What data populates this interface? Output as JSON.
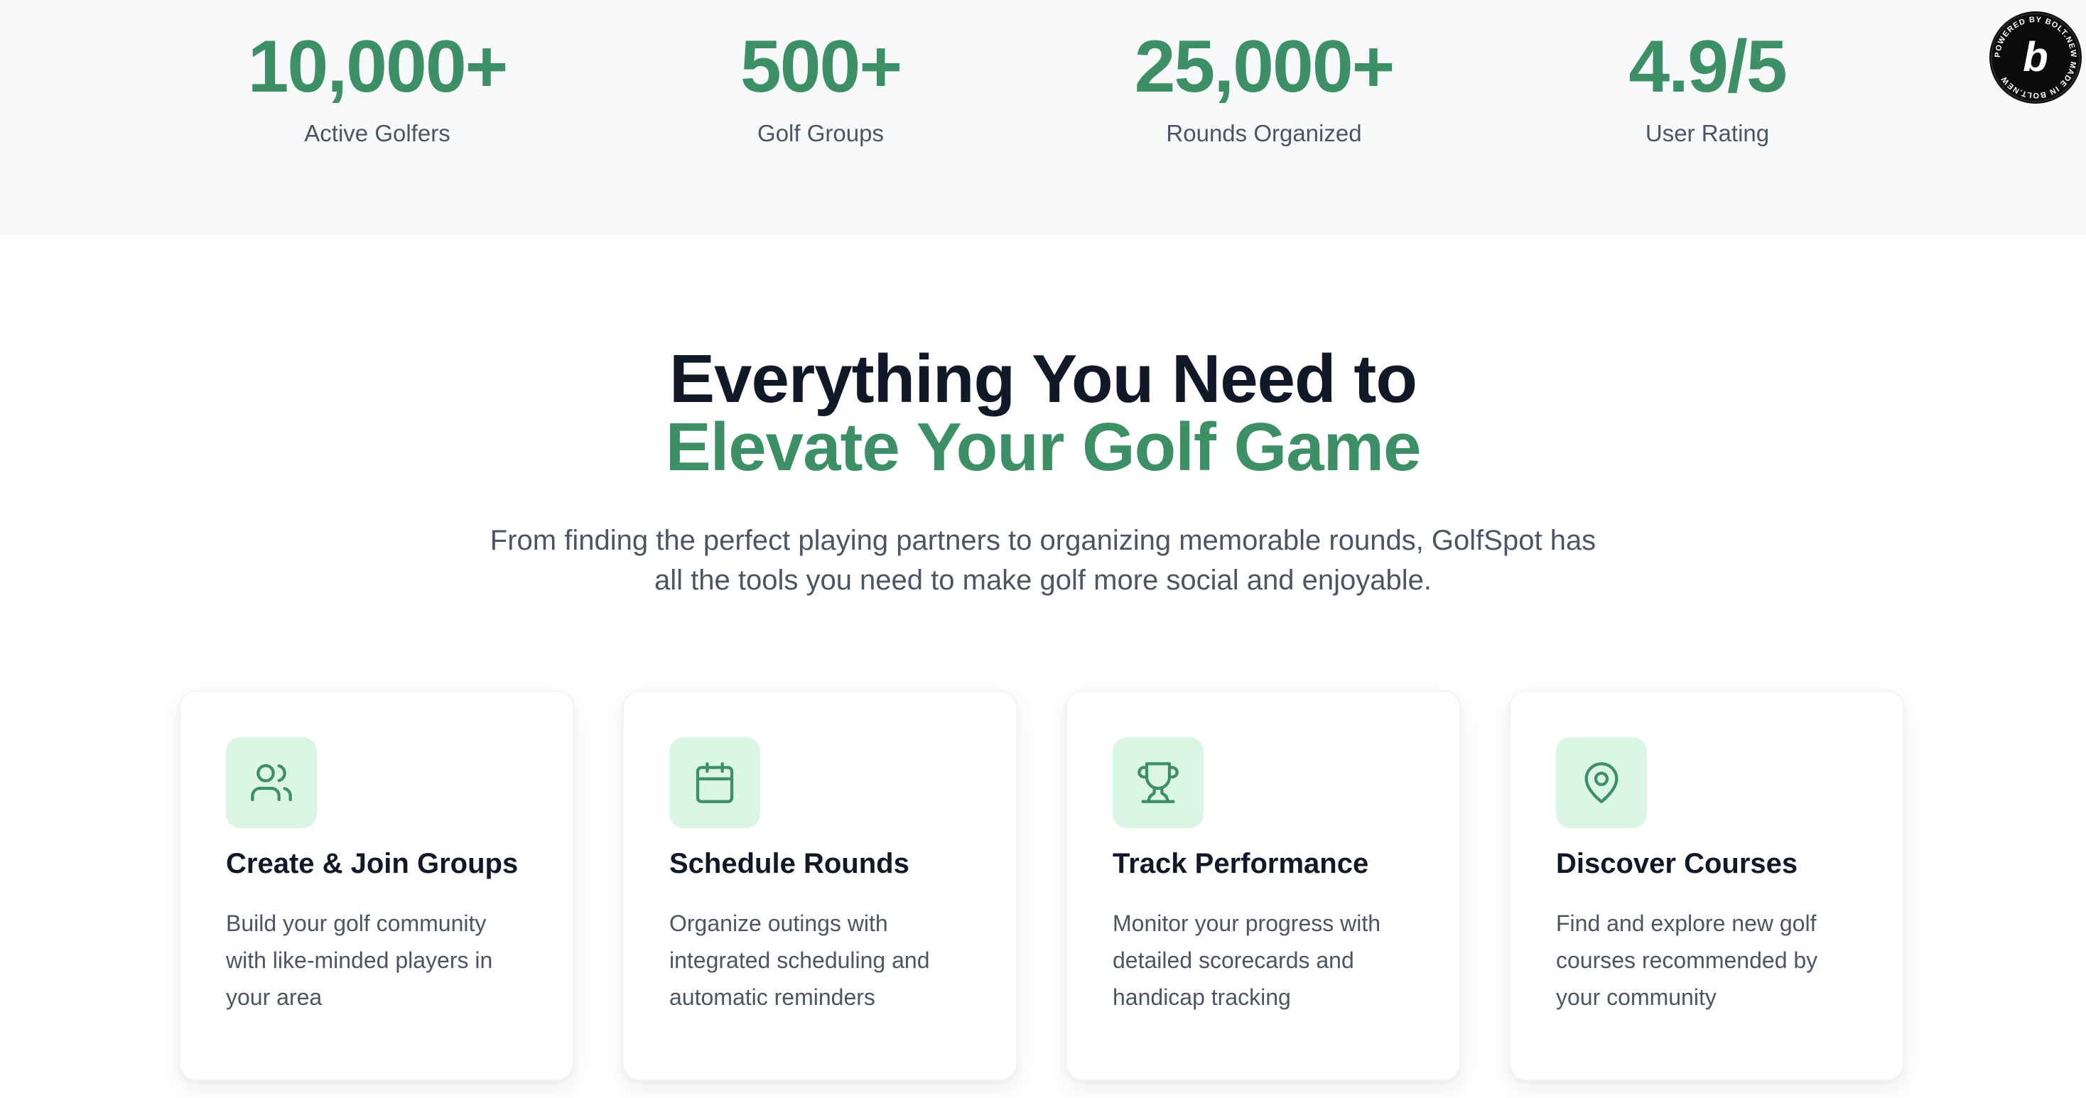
{
  "stats": [
    {
      "value": "10,000+",
      "label": "Active Golfers"
    },
    {
      "value": "500+",
      "label": "Golf Groups"
    },
    {
      "value": "25,000+",
      "label": "Rounds Organized"
    },
    {
      "value": "4.9/5",
      "label": "User Rating"
    }
  ],
  "badge": {
    "icon": "bolt-logo-icon",
    "letter": "b",
    "ring_text": "POWERED BY BOLT.NEW MADE IN BOLT.NEW"
  },
  "features": {
    "heading_line1": "Everything You Need to",
    "heading_line2": "Elevate Your Golf Game",
    "subtitle": "From finding the perfect playing partners to organizing memorable rounds, GolfSpot has all the tools you need to make golf more social and enjoyable.",
    "cards": [
      {
        "icon": "users-icon",
        "title": "Create & Join Groups",
        "description": "Build your golf community with like-minded players in your area"
      },
      {
        "icon": "calendar-icon",
        "title": "Schedule Rounds",
        "description": "Organize outings with integrated scheduling and automatic reminders"
      },
      {
        "icon": "trophy-icon",
        "title": "Track Performance",
        "description": "Monitor your progress with detailed scorecards and handicap tracking"
      },
      {
        "icon": "map-pin-icon",
        "title": "Discover Courses",
        "description": "Find and explore new golf courses recommended by your community"
      }
    ]
  },
  "colors": {
    "accent": "#3d8f65",
    "icon_bg": "#dcf6e6",
    "heading": "#111827",
    "body_text": "#4b5563",
    "band_bg": "#f8f9fb"
  }
}
